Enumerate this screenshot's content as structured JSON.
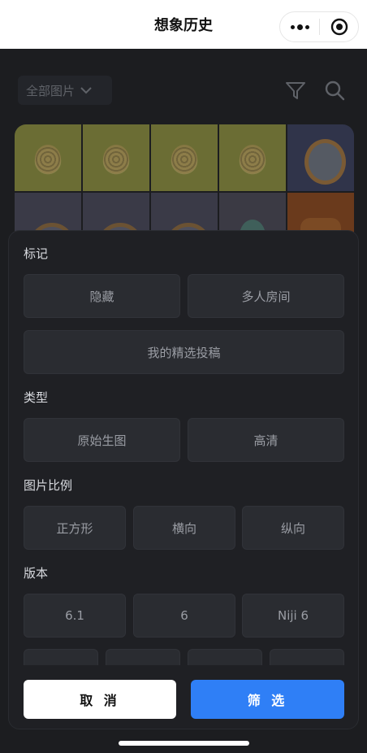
{
  "app": {
    "title": "想象历史"
  },
  "page": {
    "dropdown_label": "全部图片",
    "thumbnails": [
      "durian",
      "durian",
      "durian",
      "durian",
      "clock",
      "clock2",
      "clock2",
      "clock2",
      "teal",
      "orange"
    ]
  },
  "filter": {
    "sections": {
      "marks": {
        "title": "标记",
        "options": [
          "隐藏",
          "多人房间",
          "我的精选投稿"
        ]
      },
      "type": {
        "title": "类型",
        "options": [
          "原始生图",
          "高清"
        ]
      },
      "ratio": {
        "title": "图片比例",
        "options": [
          "正方形",
          "横向",
          "纵向"
        ]
      },
      "version": {
        "title": "版本",
        "options": [
          "6.1",
          "6",
          "Niji 6",
          "",
          "",
          "",
          ""
        ]
      }
    },
    "cancel_label": "取 消",
    "confirm_label": "筛 选"
  },
  "colors": {
    "accent": "#2f7ff6",
    "sheet_bg": "#1f2024",
    "chip_bg": "#2a2c31"
  },
  "icons": [
    "more-icon",
    "close-circle-icon",
    "chevron-down-icon",
    "filter-icon",
    "search-icon"
  ]
}
